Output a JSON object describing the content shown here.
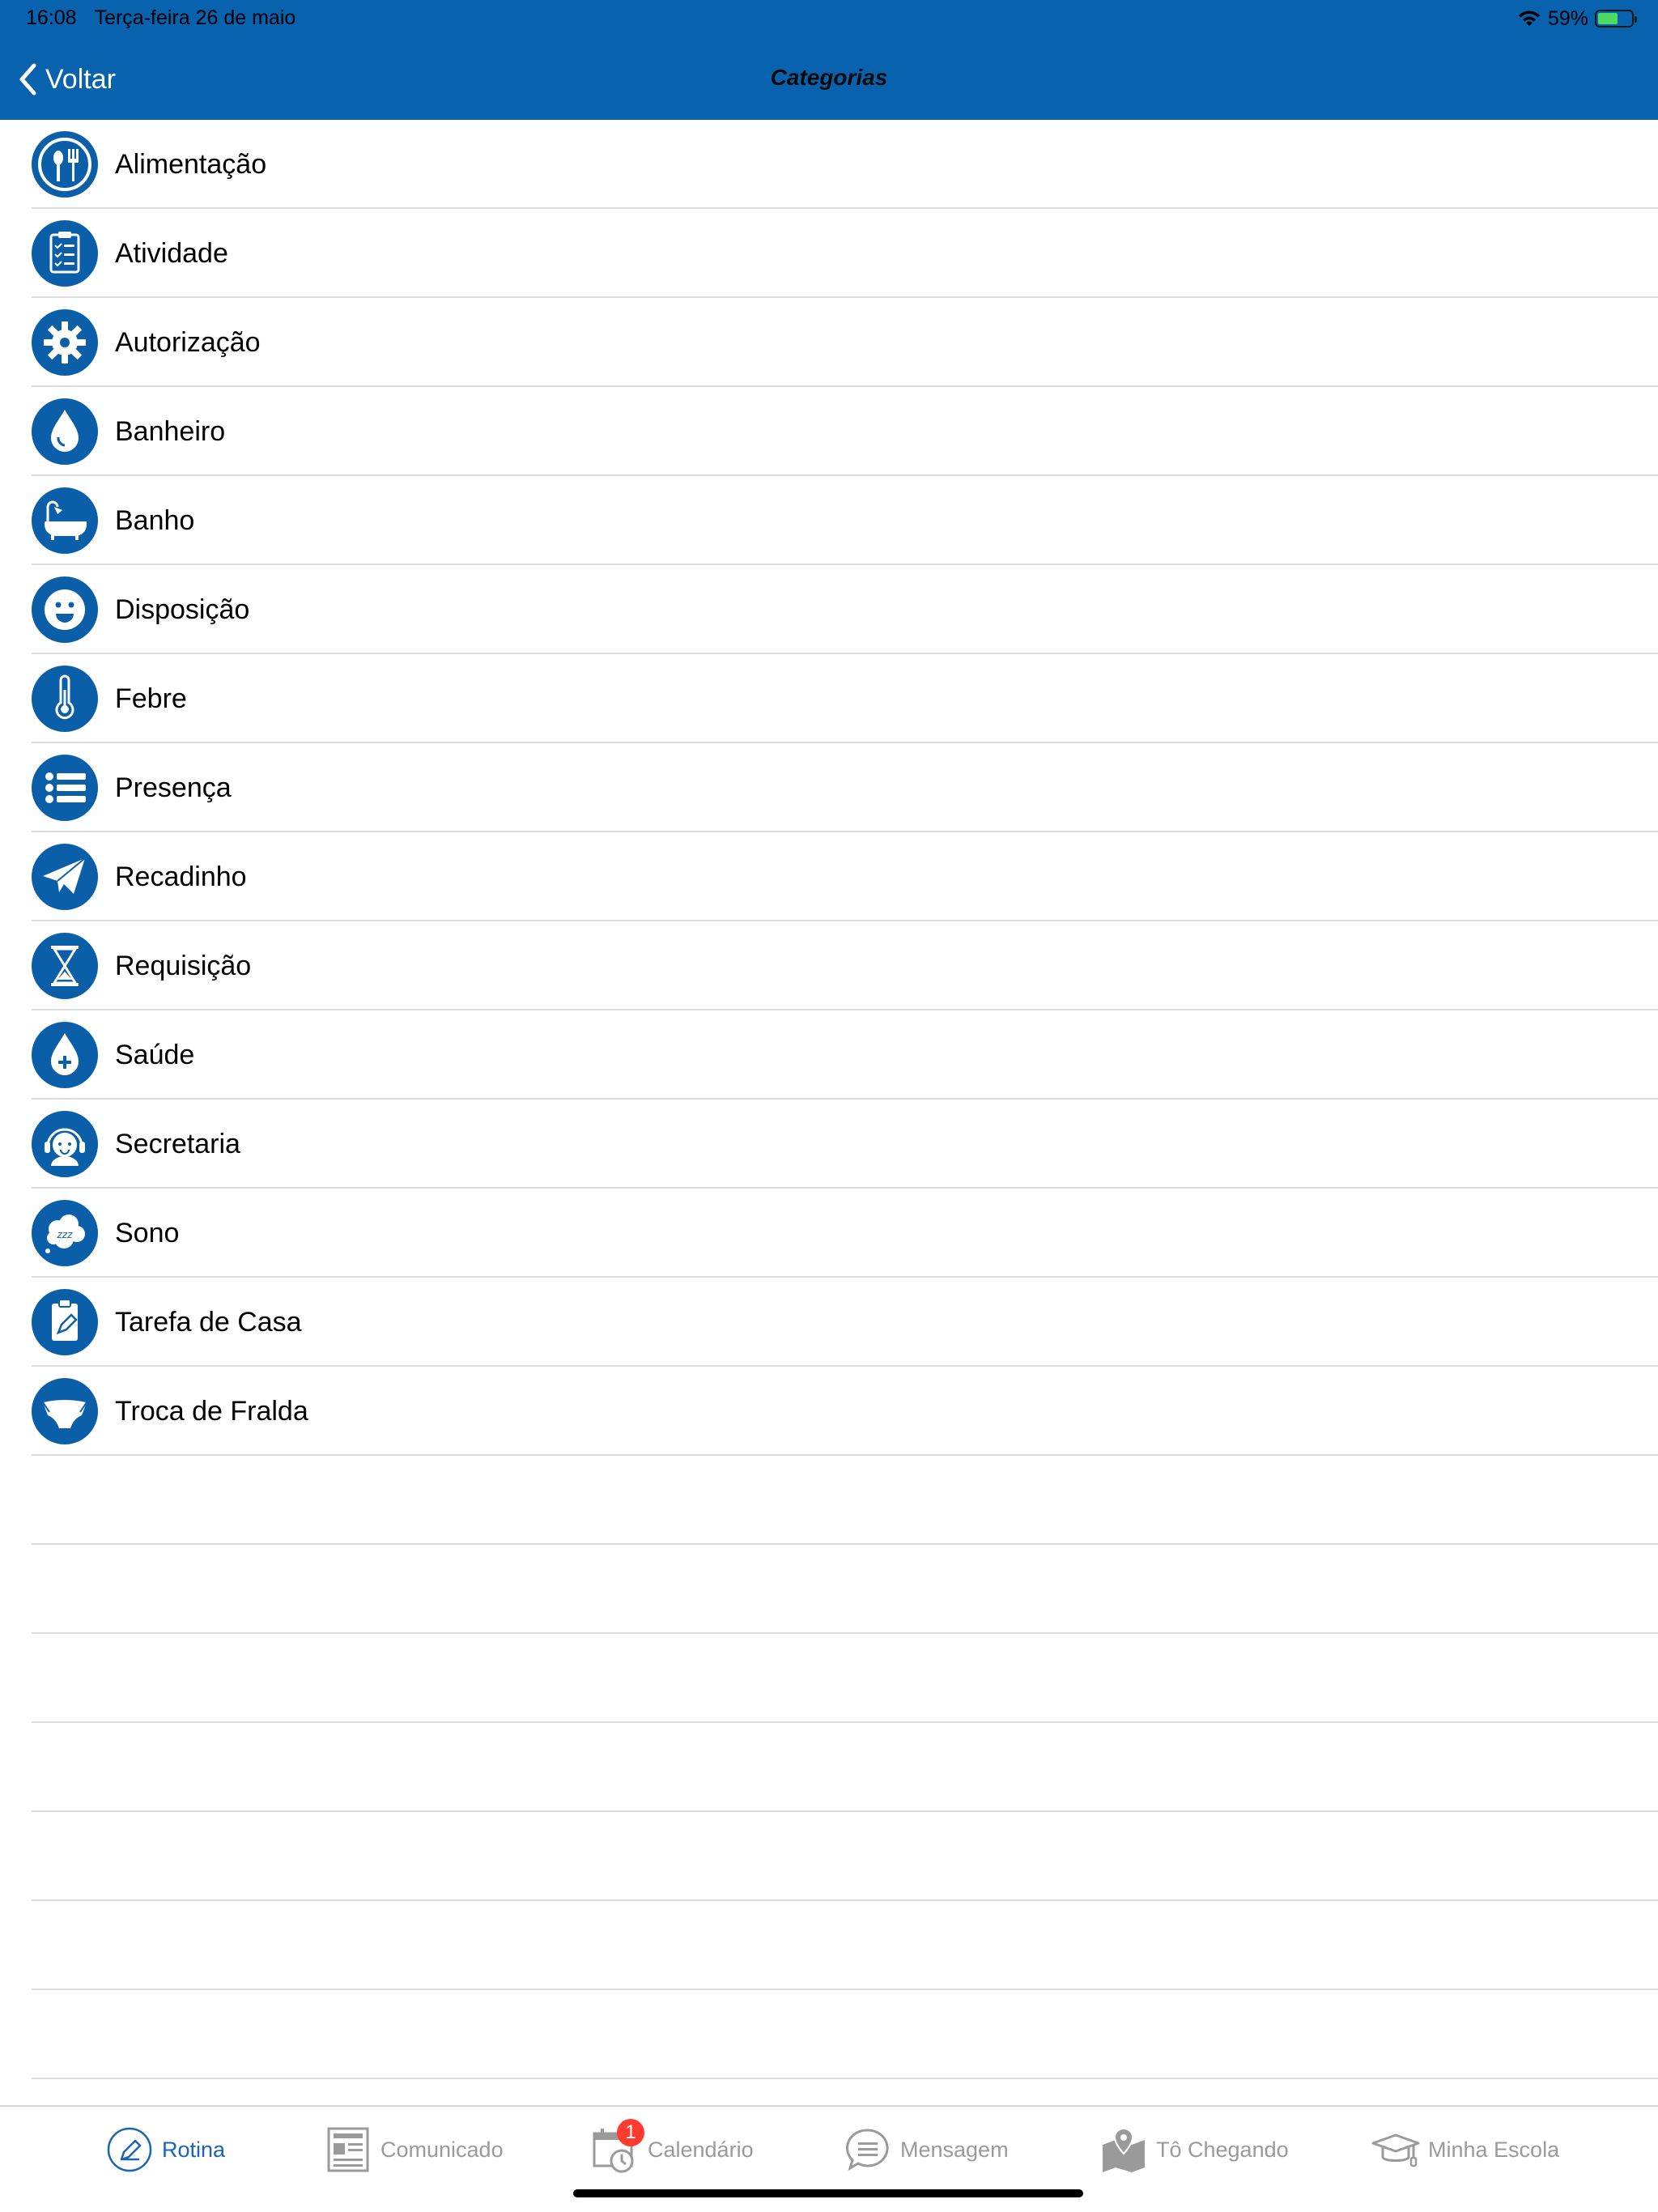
{
  "status_bar": {
    "time": "16:08",
    "date": "Terça-feira 26 de maio",
    "battery_percent": "59%",
    "battery_level": 0.59
  },
  "nav": {
    "back_label": "Voltar",
    "title": "Categorias"
  },
  "categories": [
    {
      "label": "Alimentação",
      "icon": "fork-spoon-icon"
    },
    {
      "label": "Atividade",
      "icon": "clipboard-checklist-icon"
    },
    {
      "label": "Autorização",
      "icon": "gear-icon"
    },
    {
      "label": "Banheiro",
      "icon": "water-drop-icon"
    },
    {
      "label": "Banho",
      "icon": "bathtub-icon"
    },
    {
      "label": "Disposição",
      "icon": "smiley-face-icon"
    },
    {
      "label": "Febre",
      "icon": "thermometer-icon"
    },
    {
      "label": "Presença",
      "icon": "list-icon"
    },
    {
      "label": "Recadinho",
      "icon": "paper-plane-icon"
    },
    {
      "label": "Requisição",
      "icon": "hourglass-icon"
    },
    {
      "label": "Saúde",
      "icon": "health-drop-plus-icon"
    },
    {
      "label": "Secretaria",
      "icon": "headset-person-icon"
    },
    {
      "label": "Sono",
      "icon": "sleep-cloud-icon"
    },
    {
      "label": "Tarefa de Casa",
      "icon": "clipboard-pencil-icon"
    },
    {
      "label": "Troca de Fralda",
      "icon": "diaper-icon"
    }
  ],
  "tabbar": {
    "tabs": [
      {
        "label": "Rotina",
        "icon": "pencil-circle-icon",
        "active": true
      },
      {
        "label": "Comunicado",
        "icon": "newspaper-icon"
      },
      {
        "label": "Calendário",
        "icon": "calendar-clock-icon",
        "badge": "1"
      },
      {
        "label": "Mensagem",
        "icon": "chat-bubble-icon"
      },
      {
        "label": "Tô Chegando",
        "icon": "map-pin-icon"
      },
      {
        "label": "Minha Escola",
        "icon": "graduation-cap-icon"
      }
    ]
  },
  "colors": {
    "header": "#0862ad",
    "icon_bg": "#0b5fa8",
    "active_tab": "#1a64b4",
    "inactive_tab": "#9a9a9a",
    "badge": "#ff3b30"
  }
}
